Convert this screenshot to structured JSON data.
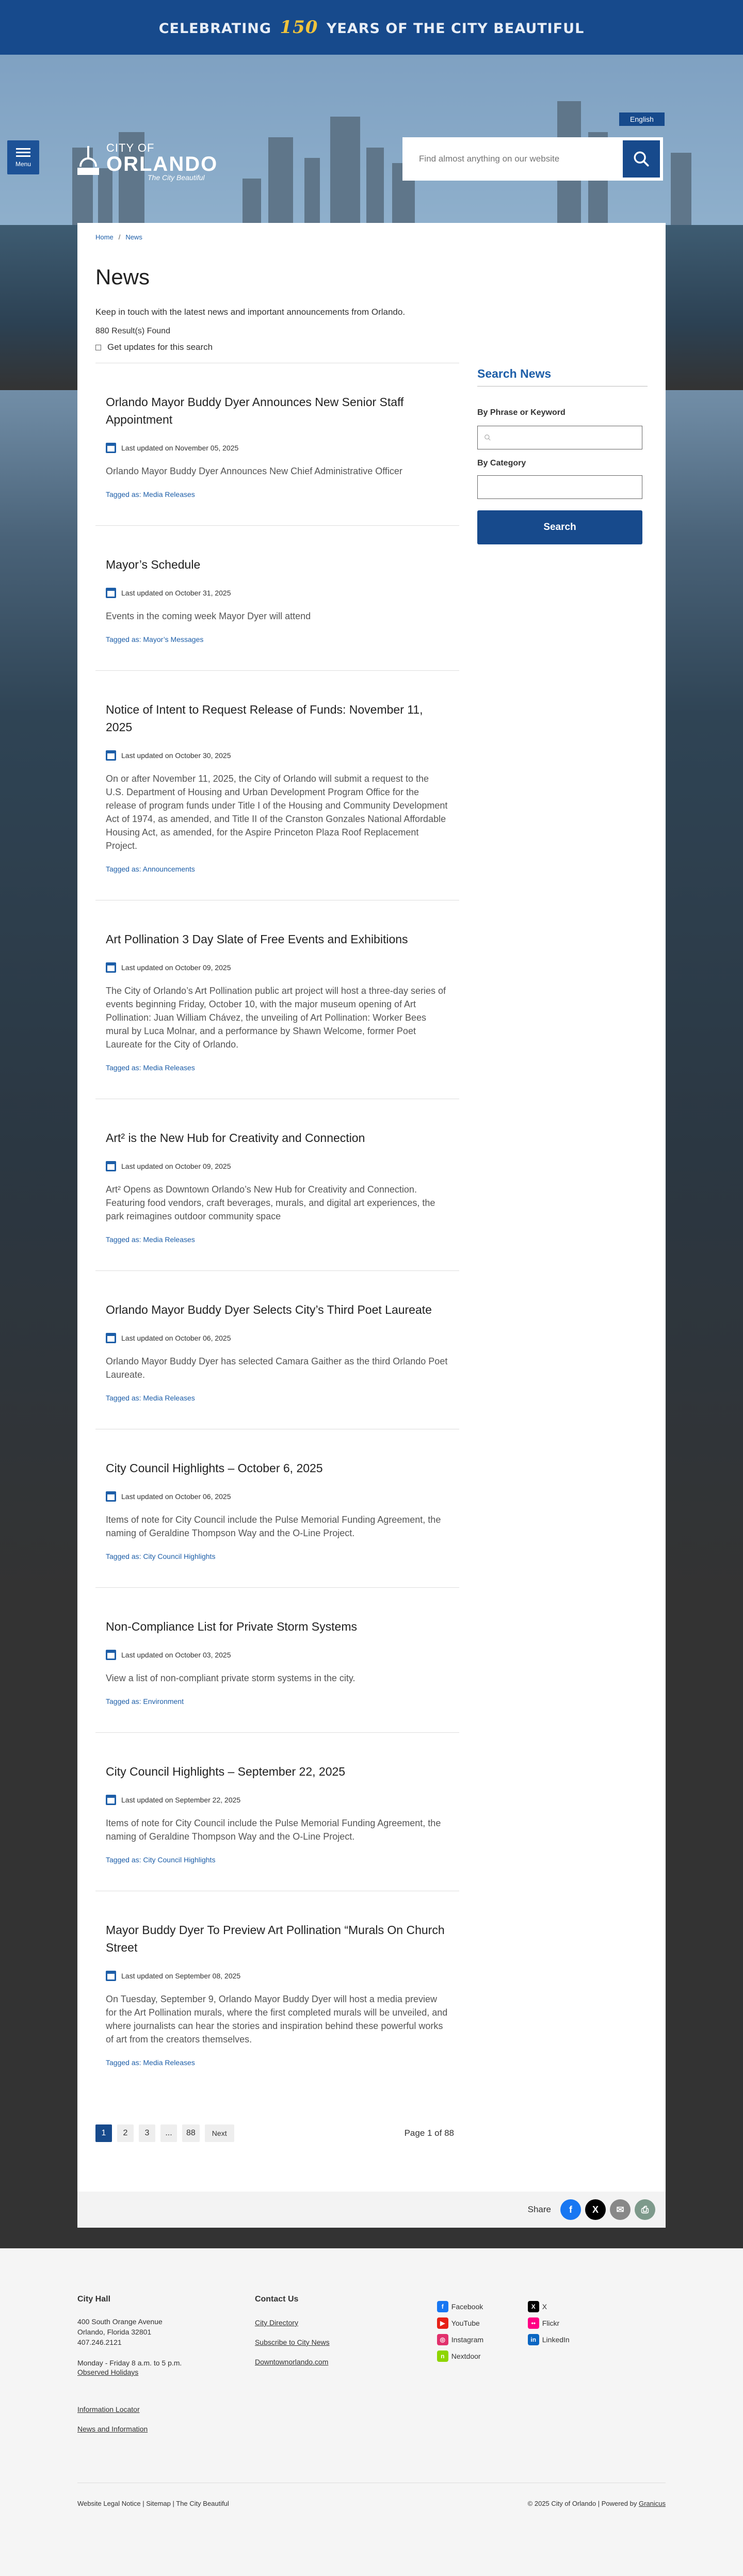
{
  "banner": {
    "prefix": "CELEBRATING",
    "number": "150",
    "suffix": "YEARS OF THE CITY BEAUTIFUL"
  },
  "header": {
    "language": "English",
    "menu_label": "Menu",
    "logo": {
      "city": "CITY OF",
      "orlando": "ORLANDO",
      "tagline": "The City Beautiful"
    },
    "search_placeholder": "Find almost anything on our website"
  },
  "breadcrumb": {
    "home": "Home",
    "separator": "/",
    "current": "News"
  },
  "page": {
    "title": "News",
    "intro": "Keep in touch with the latest news and important announcements from Orlando.",
    "result_count": "880 Result(s) Found",
    "updates_label": "Get updates for this search"
  },
  "results": [
    {
      "title": "Orlando Mayor Buddy Dyer Announces New Senior Staff Appointment",
      "date": "Last updated on November 05, 2025",
      "desc": "Orlando Mayor Buddy Dyer Announces New Chief Administrative Officer",
      "tag": "Tagged as: Media Releases"
    },
    {
      "title": "Mayor’s Schedule",
      "date": "Last updated on October 31, 2025",
      "desc": "Events in the coming week Mayor Dyer will attend",
      "tag": "Tagged as: Mayor’s Messages"
    },
    {
      "title": "Notice of Intent to Request Release of Funds: November 11, 2025",
      "date": "Last updated on October 30, 2025",
      "desc": "On or after November 11, 2025, the City of Orlando will submit a request to the U.S. Department of Housing and Urban Development Program Office for the release of program funds under Title I of the Housing and Community Development Act of 1974, as amended, and Title II of the Cranston Gonzales National Affordable Housing Act, as amended, for the Aspire Princeton Plaza Roof Replacement Project.",
      "tag": "Tagged as: Announcements"
    },
    {
      "title": "Art Pollination 3 Day Slate of Free Events and Exhibitions",
      "date": "Last updated on October 09, 2025",
      "desc": "The City of Orlando’s Art Pollination public art project will host a three-day series of events beginning Friday, October 10, with the major museum opening of Art Pollination: Juan William Chávez, the unveiling of Art Pollination: Worker Bees mural by Luca Molnar, and a performance by Shawn Welcome, former Poet Laureate for the City of Orlando.",
      "tag": "Tagged as: Media Releases"
    },
    {
      "title": "Art² is the New Hub for Creativity and Connection",
      "date": "Last updated on October 09, 2025",
      "desc": "Art² Opens as Downtown Orlando’s New Hub for Creativity and Connection. Featuring food vendors, craft beverages, murals, and digital art experiences, the park reimagines outdoor community space",
      "tag": "Tagged as: Media Releases"
    },
    {
      "title": "Orlando Mayor Buddy Dyer Selects City’s Third Poet Laureate",
      "date": "Last updated on October 06, 2025",
      "desc": "Orlando Mayor Buddy Dyer has selected Camara Gaither as the third Orlando Poet Laureate.",
      "tag": "Tagged as: Media Releases"
    },
    {
      "title": "City Council Highlights – October 6, 2025",
      "date": "Last updated on October 06, 2025",
      "desc": "Items of note for City Council include the Pulse Memorial Funding Agreement, the naming of Geraldine Thompson Way and the O-Line Project.",
      "tag": "Tagged as: City Council Highlights"
    },
    {
      "title": "Non-Compliance List for Private Storm Systems",
      "date": "Last updated on October 03, 2025",
      "desc": "View a list of non-compliant private storm systems in the city.",
      "tag": "Tagged as: Environment"
    },
    {
      "title": "City Council Highlights – September 22, 2025",
      "date": "Last updated on September 22, 2025",
      "desc": "Items of note for City Council include the Pulse Memorial Funding Agreement, the naming of Geraldine Thompson Way and the O-Line Project.",
      "tag": "Tagged as: City Council Highlights"
    },
    {
      "title": "Mayor Buddy Dyer To Preview Art Pollination “Murals On Church Street",
      "date": "Last updated on September 08, 2025",
      "desc": "On Tuesday, September 9, Orlando Mayor Buddy Dyer will host a media preview for the Art Pollination murals, where the first completed murals will be unveiled, and where journalists can hear the stories and inspiration behind these powerful works of art from the creators themselves.",
      "tag": "Tagged as: Media Releases"
    }
  ],
  "sidebar": {
    "title": "Search News",
    "phrase_label": "By Phrase or Keyword",
    "category_label": "By Category",
    "search_button": "Search"
  },
  "pagination": {
    "pages": [
      "1",
      "2",
      "3",
      "...",
      "88"
    ],
    "next": "Next",
    "status": "Page 1 of 88"
  },
  "share": {
    "label": "Share"
  },
  "footer": {
    "city_hall": {
      "heading": "City Hall",
      "address1": "400 South Orange Avenue",
      "address2": "Orlando, Florida 32801",
      "phone": "407.246.2121",
      "hours": "Monday - Friday 8 a.m. to 5 p.m.",
      "holidays": "Observed Holidays",
      "locator": "Information Locator",
      "news": "News and Information"
    },
    "contact": {
      "heading": "Contact Us",
      "directory": "City Directory",
      "subscribe": "Subscribe to City News",
      "downtown": "Downtownorlando.com"
    },
    "social": [
      {
        "name": "Facebook",
        "icon": "facebook-icon",
        "color": "#1877f2",
        "glyph": "f"
      },
      {
        "name": "X",
        "icon": "x-icon",
        "color": "#000000",
        "glyph": "X"
      },
      {
        "name": "YouTube",
        "icon": "youtube-icon",
        "color": "#e62117",
        "glyph": "▶"
      },
      {
        "name": "Flickr",
        "icon": "flickr-icon",
        "color": "#ff0084",
        "glyph": "••"
      },
      {
        "name": "Instagram",
        "icon": "instagram-icon",
        "color": "#e1306c",
        "glyph": "◎"
      },
      {
        "name": "LinkedIn",
        "icon": "linkedin-icon",
        "color": "#0a66c2",
        "glyph": "in"
      },
      {
        "name": "Nextdoor",
        "icon": "nextdoor-icon",
        "color": "#8ed500",
        "glyph": "n"
      }
    ],
    "bottom_left": "Website Legal Notice | Sitemap | The City Beautiful",
    "bottom_right_prefix": "© 2025 City of Orlando | Powered by ",
    "bottom_right_link": "Granicus"
  },
  "colors": {
    "brand_blue": "#174a8c",
    "link_blue": "#1d5ea8",
    "anniversary_gold": "#f0c33c"
  }
}
